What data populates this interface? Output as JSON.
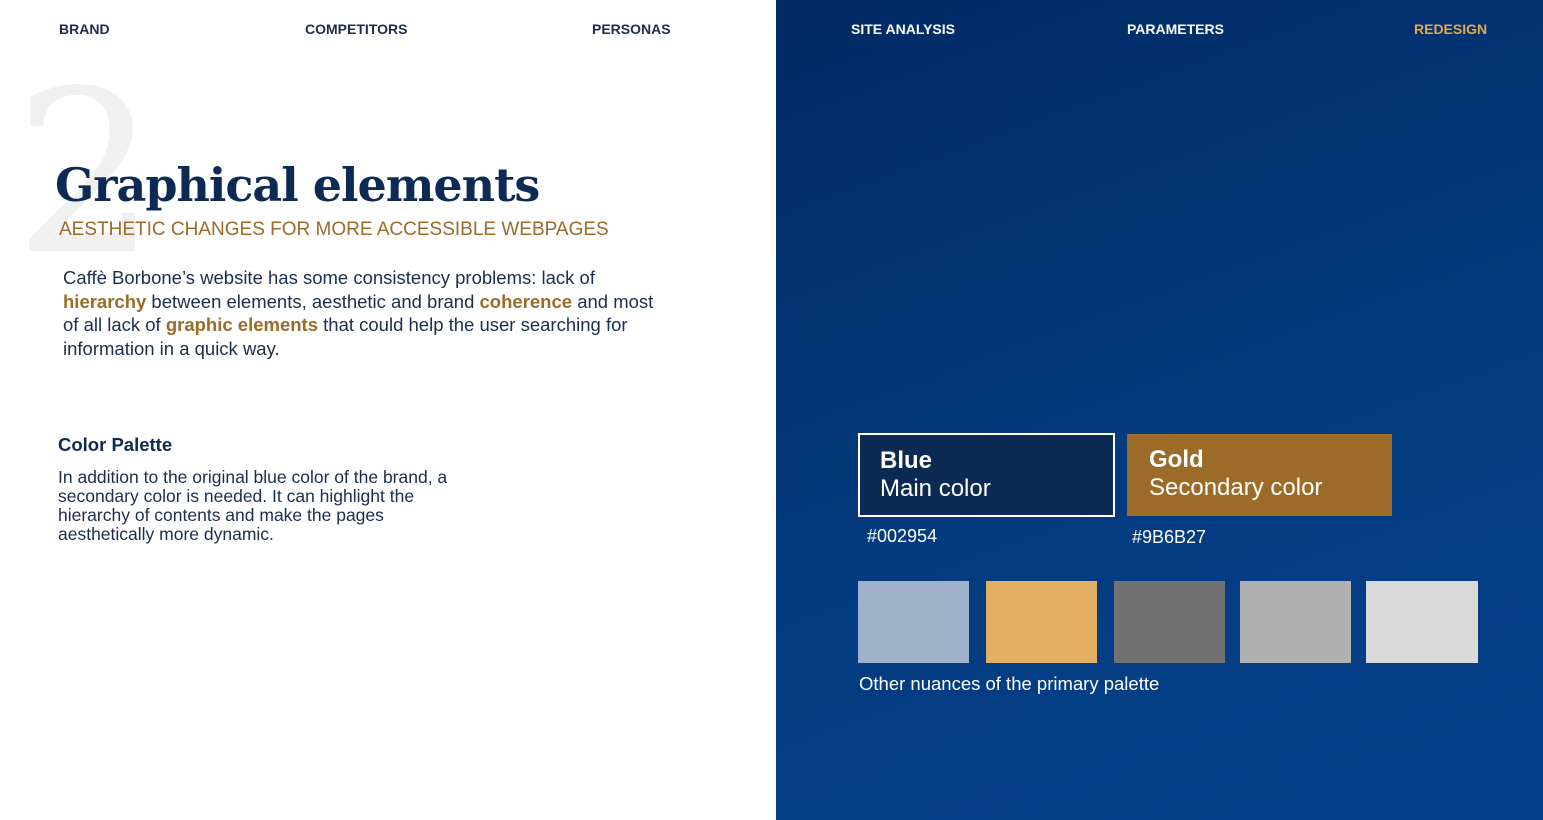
{
  "nav": [
    {
      "label": "BRAND"
    },
    {
      "label": "COMPETITORS"
    },
    {
      "label": "PERSONAS"
    },
    {
      "label": "SITE ANALYSIS"
    },
    {
      "label": "PARAMETERS"
    },
    {
      "label": "REDESIGN",
      "active": true
    }
  ],
  "section_number": "2",
  "title": "Graphical elements",
  "subtitle": "AESTHETIC CHANGES FOR MORE ACCESSIBLE WEBPAGES",
  "intro": {
    "t1": "Caffè Borbone’s website has some consistency problems: lack of ",
    "h1": "hierarchy",
    "t2": " between elements, aesthetic and brand ",
    "h2": "coherence",
    "t3": " and most of all lack of ",
    "h3": "graphic elements",
    "t4": " that could help the user searching for information in a quick way."
  },
  "palette": {
    "heading": "Color Palette",
    "description": "In addition to the original blue color of the brand, a secondary color is needed. It can highlight the hierarchy of contents and make the pages aesthetically more dynamic."
  },
  "main_colors": [
    {
      "name": "Blue",
      "role": "Main color",
      "hex": "#002954"
    },
    {
      "name": "Gold",
      "role": "Secondary color",
      "hex": "#9B6B27"
    }
  ],
  "nuances": {
    "colors": [
      "#9fb2c9",
      "#e1b062",
      "#717171",
      "#b0b0b0",
      "#d9d9d9"
    ],
    "caption": "Other nuances of the primary palette"
  }
}
